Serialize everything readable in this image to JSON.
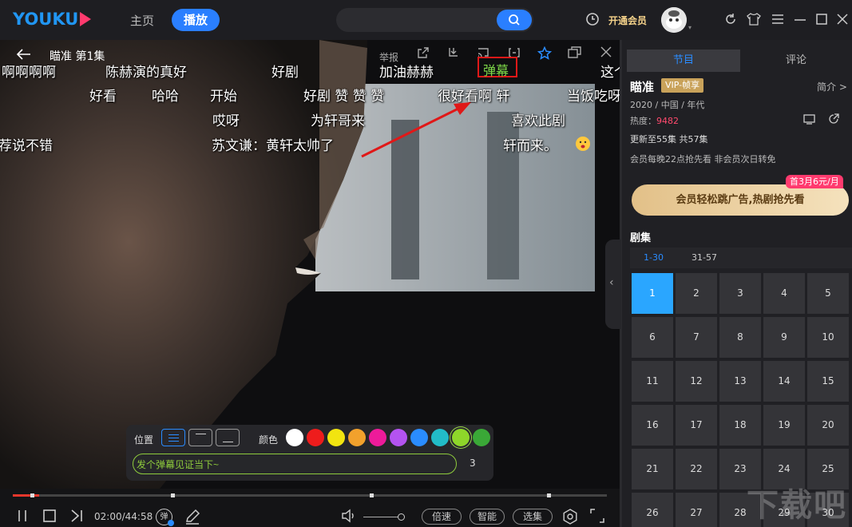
{
  "topbar": {
    "logo_text": "YOUKU",
    "nav_home": "主页",
    "nav_play": "播放",
    "search_placeholder": "",
    "vip_open": "开通会员"
  },
  "video": {
    "title": "瞄准 第1集",
    "report": "举报",
    "danmu_button": "弹幕",
    "danmaku": [
      {
        "text": "啊啊啊啊"
      },
      {
        "text": "陈赫演的真好"
      },
      {
        "text": "好剧"
      },
      {
        "text": "加油赫赫"
      },
      {
        "text": "这个"
      },
      {
        "text": "好看"
      },
      {
        "text": "哈哈"
      },
      {
        "text": "开始"
      },
      {
        "text": "好剧 赞 赞 赞"
      },
      {
        "text": "很好看啊 轩"
      },
      {
        "text": "当饭吃呀"
      },
      {
        "text": "哎呀"
      },
      {
        "text": "为轩哥来"
      },
      {
        "text": "喜欢此剧"
      },
      {
        "text": "荐说不错"
      },
      {
        "text": "苏文谦：黄轩太帅了"
      },
      {
        "text": "轩而来。"
      }
    ]
  },
  "danmu_panel": {
    "position_label": "位置",
    "color_label": "颜色",
    "colors": [
      "#ffffff",
      "#ee1c1c",
      "#f2e410",
      "#f2a12c",
      "#ee1b9a",
      "#b453f0",
      "#2a8cff",
      "#22bcc8",
      "#8ed62a",
      "#3aa837"
    ],
    "selected_color": "#8ed62a",
    "input_placeholder": "发个弹幕见证当下~",
    "char_count": "3"
  },
  "controls": {
    "time": "02:00/44:58",
    "progress_fraction": 0.045,
    "danmu_toggle": "弹",
    "speed": "倍速",
    "smart": "智能",
    "episodes": "选集"
  },
  "panel": {
    "tab_program": "节目",
    "tab_comments": "评论",
    "show_title": "瞄准",
    "vip_badge": "VIP-帧享",
    "intro_link": "简介 >",
    "meta": "2020 / 中国 / 年代",
    "heat_label": "热度：",
    "heat_value": "9482",
    "updated": "更新至55集 共57集",
    "schedule": "会员每晚22点抢先看 非会员次日转免",
    "promo_tag": "首3月6元/月",
    "vip_cta": "会员轻松跳广告,热剧抢先看",
    "episodes_heading": "剧集",
    "ranges": [
      "1-30",
      "31-57"
    ],
    "episode_numbers": [
      "1",
      "2",
      "3",
      "4",
      "5",
      "6",
      "7",
      "8",
      "9",
      "10",
      "11",
      "12",
      "13",
      "14",
      "15",
      "16",
      "17",
      "18",
      "19",
      "20",
      "21",
      "22",
      "23",
      "24",
      "25",
      "26",
      "27",
      "28",
      "29",
      "30"
    ],
    "active_episode": "1"
  },
  "watermark": "下载吧"
}
